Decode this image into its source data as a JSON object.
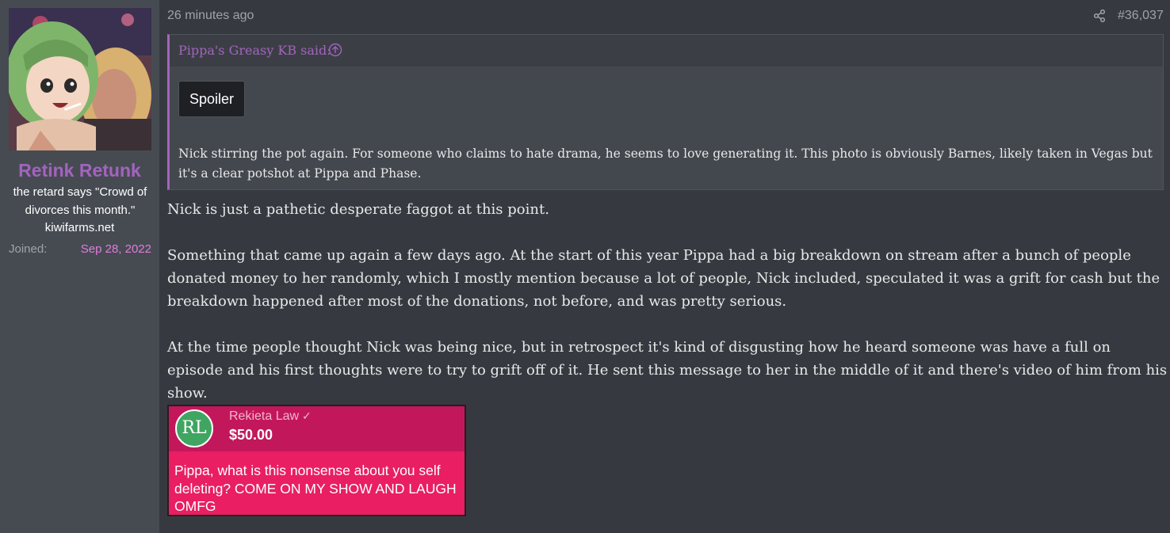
{
  "user": {
    "name": "Retink Retunk",
    "title": "the retard says \"Crowd of divorces this month.\"",
    "site": "kiwifarms.net",
    "joined_label": "Joined:",
    "joined_date": "Sep 28, 2022"
  },
  "post": {
    "time": "26 minutes ago",
    "number": "#36,037",
    "quote": {
      "author": "Pippa's Greasy KB said:",
      "spoiler_label": "Spoiler",
      "text": "Nick stirring the pot again. For someone who claims to hate drama, he seems to love generating it. This photo is obviously Barnes, likely taken in Vegas but it's a clear potshot at Pippa and Phase."
    },
    "paragraphs": [
      "Nick is just a pathetic desperate faggot at this point.",
      "Something that came up again a few days ago. At the start of this year Pippa had a big breakdown on stream after a bunch of people donated money to her randomly, which I mostly mention because a lot of people, Nick included, speculated it was a grift for cash but the breakdown happened after most of the donations, not before, and was pretty serious.",
      "At the time people thought Nick was being nice, but in retrospect it's kind of disgusting how he heard someone was have a full on episode and his first thoughts were to try to grift off of it. He sent this message to her in the middle of it and there's video of him from his show."
    ],
    "donation": {
      "logo_text": "RL",
      "name": "Rekieta Law",
      "amount": "$50.00",
      "message": "Pippa, what is this nonsense about you self deleting? COME ON MY SHOW AND LAUGH OMFG"
    }
  },
  "colors": {
    "accent": "#a463bf",
    "joined_date": "#e07ddb",
    "background": "#363a40",
    "sidebar": "#464b52",
    "donation_top": "#c2185b",
    "donation_bottom": "#e91e63"
  },
  "icons": [
    "share-icon",
    "quote-up-arrow-icon",
    "verified-check-icon"
  ]
}
